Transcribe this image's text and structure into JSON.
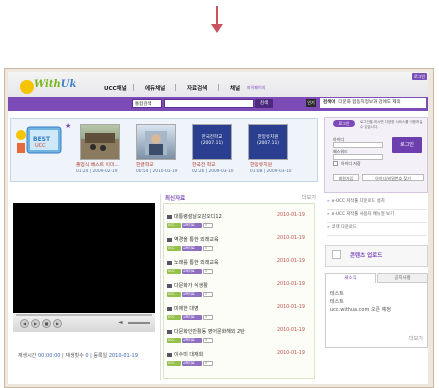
{
  "header": {
    "logo_text_a": "With",
    "logo_text_b": "Uk",
    "nav": [
      "UCC채널",
      "에듀채널",
      "자료검색",
      "채널"
    ],
    "nav_extra": "마이페이지",
    "top_button": "로그인"
  },
  "search": {
    "category": "통합검색",
    "button": "검색",
    "keyword_label": "검색어",
    "keyword_icon": "인기",
    "keyword_text": "다문화 합동지정보과 강에도 제의"
  },
  "thumbnails": [
    {
      "caption": "졸업식 베스트 이미...",
      "meta": "01:24 | 2009-02-19"
    },
    {
      "caption": "한글학교",
      "meta": "00:54 | 2010-01-19"
    },
    {
      "caption": "한국전 학교",
      "meta": "02:26 | 2009-03-10"
    },
    {
      "caption": "한망유치원",
      "meta": "01:08 | 2009-03-10"
    }
  ],
  "thumb_inner": {
    "t3": "한국전학교 (2007.11)",
    "t4": "한망유치원 (2007.11)"
  },
  "login": {
    "title": "로그인",
    "note": "로그인을 하시면 다양한 서비스를 이용하실 수 있습니다.",
    "id_label": "아이디",
    "pw_label": "패스워드",
    "save_label": "아이디 저장",
    "login_button": "로그인",
    "join_button": "회원가입",
    "find_button": "아이디/비밀번호 찾기"
  },
  "player": {
    "time_label": "재생시간",
    "time_value": "00:00:00",
    "views_label": "재생횟수",
    "views_value": "0",
    "date_label": "등록일",
    "date_value": "2010-01-19"
  },
  "latest": {
    "title": "최신자료",
    "more": "더보기",
    "items": [
      {
        "title": "대통령설날오감오디12",
        "date": "2010-01-19"
      },
      {
        "title": "역경을 통한 외래교육",
        "date": "2010-01-19"
      },
      {
        "title": "노래를 통한 외래교육",
        "date": "2010-01-19"
      },
      {
        "title": "다문화가 식생활",
        "date": "2010-01-19"
      },
      {
        "title": "미에한 대영",
        "date": "2010-01-19"
      },
      {
        "title": "다문화인만활동 영어문화해외 2탄",
        "date": "2010-01-19"
      },
      {
        "title": "이수미 대재회",
        "date": "2010-01-19"
      }
    ],
    "tag_a": "UCC",
    "tag_b": "교육자료",
    "tag_c": "5"
  },
  "links": [
    "e-UCC 저작툴 다운로드 설치",
    "e-UCC 저작툴 사용자 매뉴얼 보기",
    "코덱 다운로드"
  ],
  "upload": {
    "label": "콘텐츠 업로드"
  },
  "notice": {
    "tabs": [
      "새소식",
      "공지사항"
    ],
    "items": [
      "테스트",
      "테스트",
      "ucc.withua.com 오픈 예정"
    ],
    "more": "더보기"
  },
  "colors": {
    "accent": "#7d4bb8",
    "arrow": "#c9545e",
    "date": "#c0504d"
  }
}
